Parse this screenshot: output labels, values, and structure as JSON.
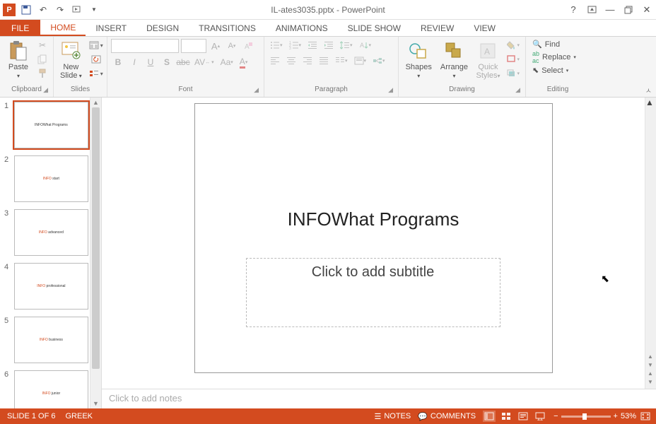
{
  "titlebar": {
    "title": "IL-ates3035.pptx - PowerPoint"
  },
  "tabs": {
    "file": "FILE",
    "items": [
      "HOME",
      "INSERT",
      "DESIGN",
      "TRANSITIONS",
      "ANIMATIONS",
      "SLIDE SHOW",
      "REVIEW",
      "VIEW"
    ],
    "active": "HOME"
  },
  "ribbon": {
    "clipboard": {
      "label": "Clipboard",
      "paste": "Paste"
    },
    "slides": {
      "label": "Slides",
      "newSlide": "New\nSlide"
    },
    "font": {
      "label": "Font",
      "fontName": "",
      "fontSize": ""
    },
    "paragraph": {
      "label": "Paragraph"
    },
    "drawing": {
      "label": "Drawing",
      "shapes": "Shapes",
      "arrange": "Arrange",
      "quickStyles": "Quick\nStyles"
    },
    "editing": {
      "label": "Editing",
      "find": "Find",
      "replace": "Replace",
      "select": "Select"
    }
  },
  "thumbs": [
    {
      "num": "1",
      "text": "INFOWhat Programs",
      "selected": true
    },
    {
      "num": "2",
      "text": "INFO start"
    },
    {
      "num": "3",
      "text": "INFO advanced"
    },
    {
      "num": "4",
      "text": "INFO professional"
    },
    {
      "num": "5",
      "text": "INFO business"
    },
    {
      "num": "6",
      "text": "INFO junior"
    }
  ],
  "slide": {
    "title": "INFOWhat Programs",
    "subtitlePlaceholder": "Click to add subtitle"
  },
  "notes": {
    "placeholder": "Click to add notes"
  },
  "status": {
    "slideInfo": "SLIDE 1 OF 6",
    "language": "GREEK",
    "notes": "NOTES",
    "comments": "COMMENTS",
    "zoom": "53%"
  }
}
